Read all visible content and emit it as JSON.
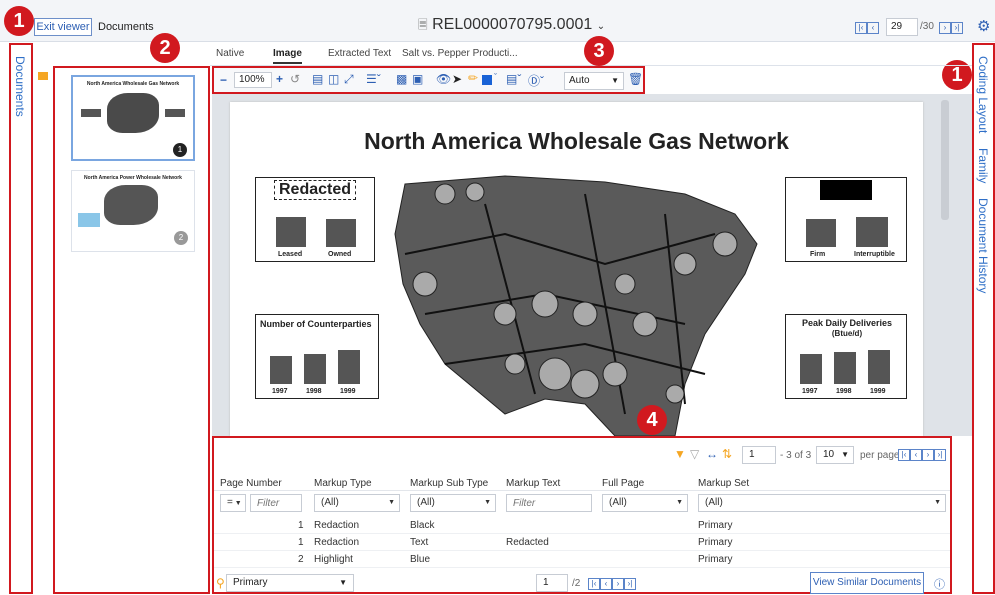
{
  "header": {
    "exit_label": "Exit viewer",
    "documents_label": "Documents",
    "doc_id": "REL0000070795.0001",
    "page_current": "29",
    "page_total": "/30"
  },
  "left_rail": {
    "label": "Documents"
  },
  "right_rail": {
    "items": [
      "Coding Layout",
      "Family",
      "Document History"
    ]
  },
  "badges": {
    "one": "1",
    "two": "2",
    "three": "3",
    "four": "4"
  },
  "tabs": [
    "Native",
    "Image",
    "Extracted Text",
    "Salt vs. Pepper Producti..."
  ],
  "toolbar": {
    "zoom": "100%",
    "auto_label": "Auto"
  },
  "thumbnails": [
    {
      "title": "North America Wholesale Gas Network",
      "page": "1"
    },
    {
      "title": "North America Power Wholesale Network",
      "page": "2"
    }
  ],
  "page": {
    "title": "North America Wholesale Gas Network",
    "redacted_label": "Redacted",
    "chart1": {
      "labels": [
        "Leased",
        "Owned"
      ]
    },
    "chart2": {
      "labels": [
        "Firm",
        "Interruptible"
      ]
    },
    "chart3": {
      "title": "Number of Counterparties",
      "labels": [
        "1997",
        "1998",
        "1999"
      ]
    },
    "chart4": {
      "title": "Peak Daily Deliveries",
      "subtitle": "(Btue/d)",
      "labels": [
        "1997",
        "1998",
        "1999"
      ]
    }
  },
  "grid": {
    "pager_value": "1",
    "pager_text": "- 3 of 3",
    "per_page_value": "10",
    "per_page_label": "per page",
    "columns": [
      "Page Number",
      "Markup Type",
      "Markup Sub Type",
      "Markup Text",
      "Full Page",
      "Markup Set"
    ],
    "filters": {
      "page_op": "=",
      "page_placeholder": "Filter",
      "type": "(All)",
      "subtype": "(All)",
      "text_placeholder": "Filter",
      "full": "(All)",
      "set": "(All)"
    },
    "rows": [
      {
        "page": "1",
        "type": "Redaction",
        "subtype": "Black",
        "text": "",
        "set": "Primary"
      },
      {
        "page": "1",
        "type": "Redaction",
        "subtype": "Text",
        "text": "Redacted",
        "set": "Primary"
      },
      {
        "page": "2",
        "type": "Highlight",
        "subtype": "Blue",
        "text": "",
        "set": "Primary"
      }
    ],
    "footer": {
      "markup_set": "Primary",
      "page_value": "1",
      "page_total": "/2",
      "similar_button": "View Similar Documents"
    }
  },
  "colors": {
    "accent": "#2d5fb3",
    "callout": "#d1191f",
    "highlight": "#f5a623"
  }
}
